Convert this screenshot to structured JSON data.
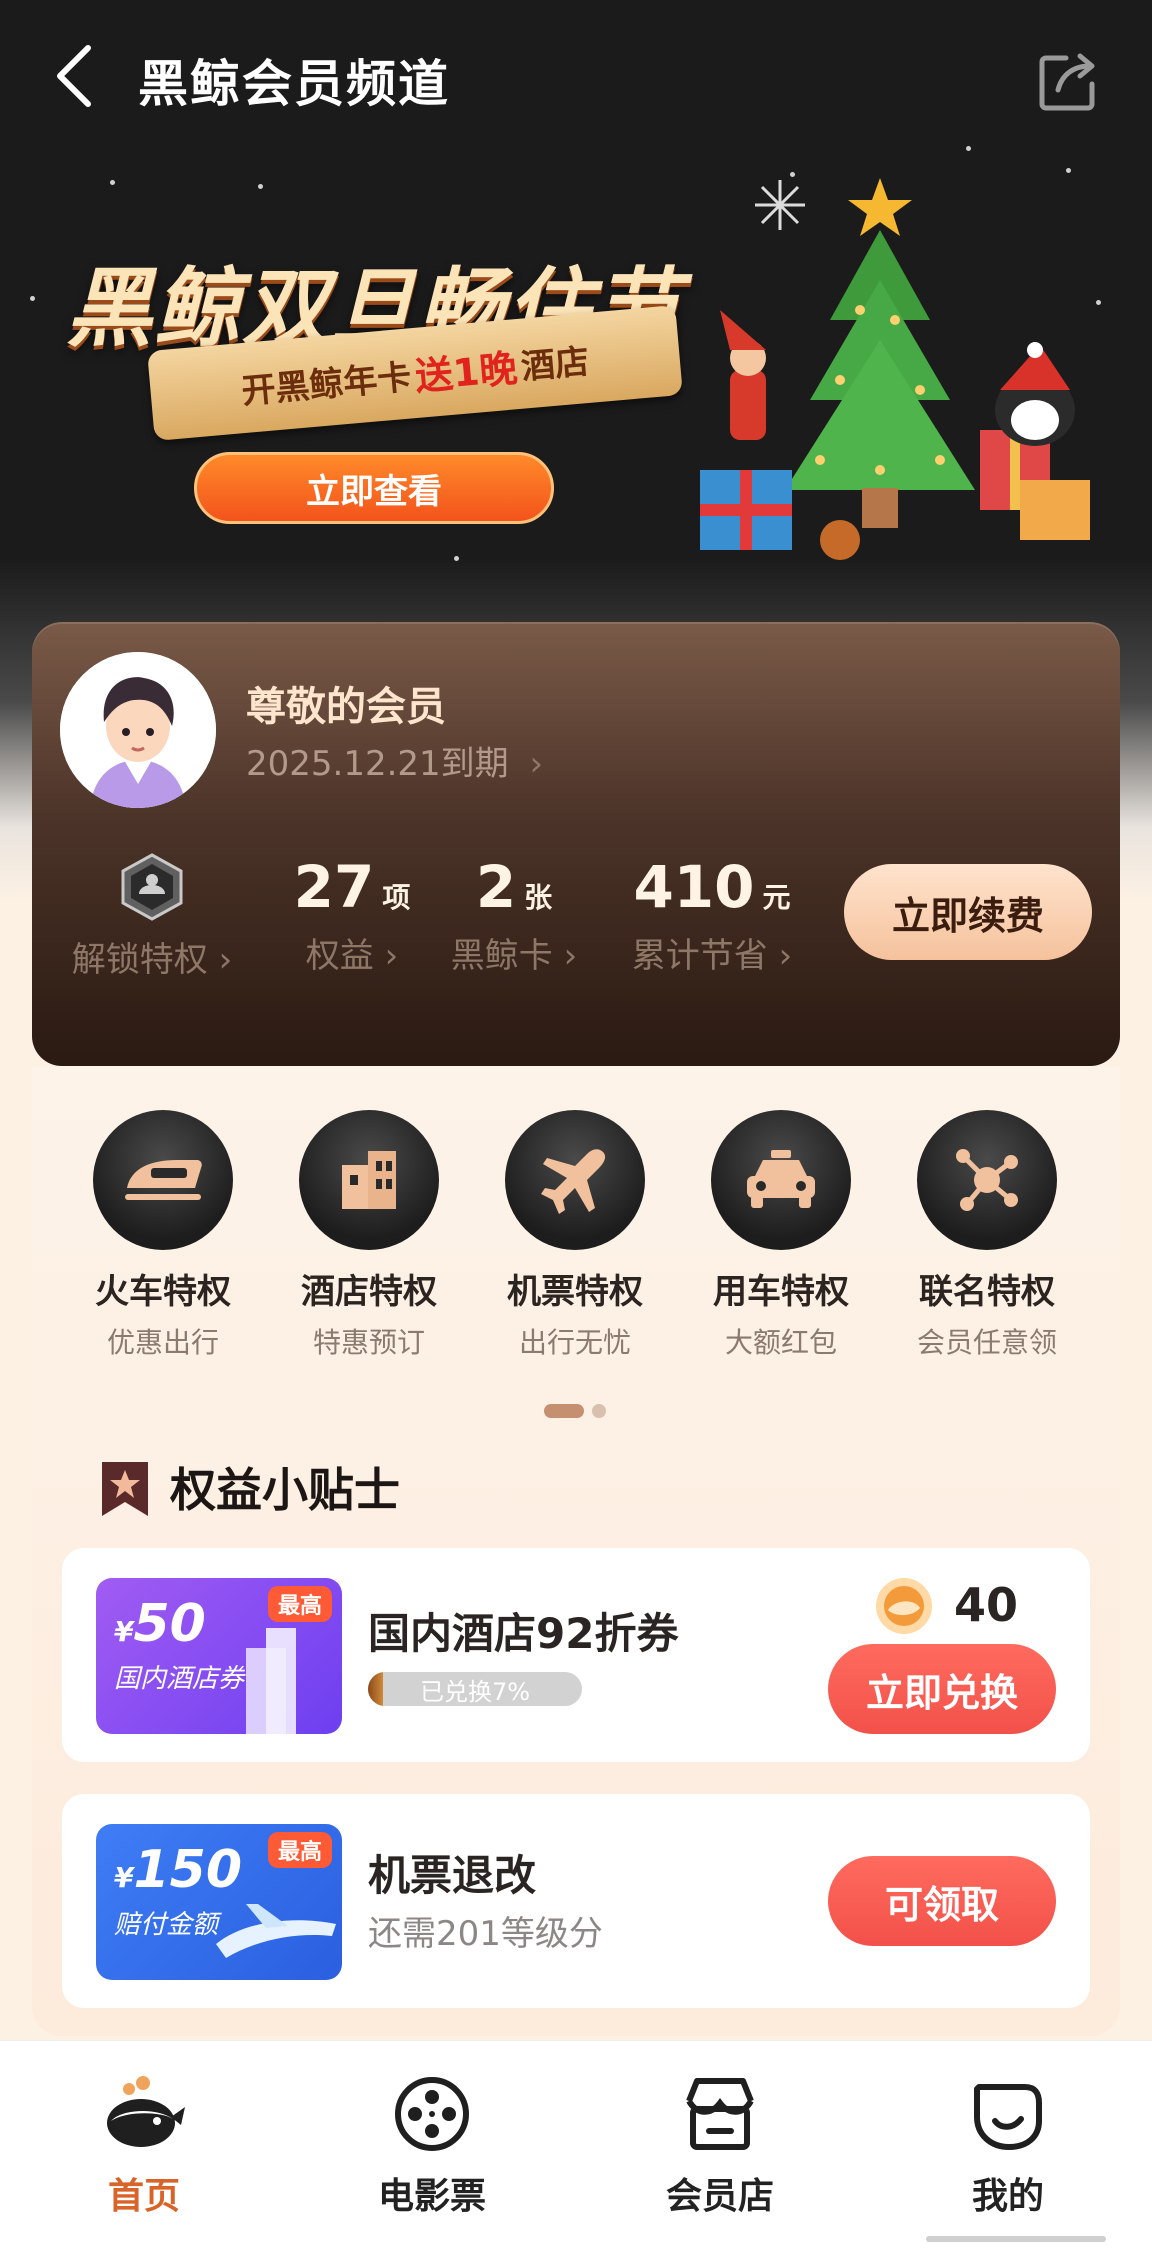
{
  "header": {
    "title": "黑鲸会员频道"
  },
  "banner": {
    "title": "黑鲸双旦畅住节",
    "ribbon_prefix": "开黑鲸年卡",
    "ribbon_highlight": "送1晚",
    "ribbon_suffix": "酒店",
    "button_label": "立即查看"
  },
  "member": {
    "name": "尊敬的会员",
    "expire": "2025.12.21到期",
    "stats": [
      {
        "value": "",
        "unit": "",
        "label": "解锁特权"
      },
      {
        "value": "27",
        "unit": "项",
        "label": "权益"
      },
      {
        "value": "2",
        "unit": "张",
        "label": "黑鲸卡"
      },
      {
        "value": "410",
        "unit": "元",
        "label": "累计节省"
      }
    ],
    "renew_label": "立即续费"
  },
  "privileges": [
    {
      "title": "火车特权",
      "sub": "优惠出行",
      "icon": "train-icon"
    },
    {
      "title": "酒店特权",
      "sub": "特惠预订",
      "icon": "hotel-icon"
    },
    {
      "title": "机票特权",
      "sub": "出行无忧",
      "icon": "plane-icon"
    },
    {
      "title": "用车特权",
      "sub": "大额红包",
      "icon": "car-icon"
    },
    {
      "title": "联名特权",
      "sub": "会员任意领",
      "icon": "cobrand-icon"
    }
  ],
  "tips": {
    "title": "权益小贴士",
    "items": [
      {
        "amount_currency": "¥",
        "amount": "50",
        "amount_desc": "国内酒店券",
        "tag": "最高",
        "name": "国内酒店92折券",
        "progress_text": "已兑换7%",
        "progress_value": 0.07,
        "coins": "40",
        "button": "立即兑换"
      },
      {
        "amount_currency": "¥",
        "amount": "150",
        "amount_desc": "赔付金额",
        "tag": "最高",
        "name": "机票退改",
        "sub": "还需201等级分",
        "button": "可领取"
      }
    ]
  },
  "nav": [
    {
      "label": "首页",
      "icon": "whale-home-icon",
      "active": true
    },
    {
      "label": "电影票",
      "icon": "film-reel-icon",
      "active": false
    },
    {
      "label": "会员店",
      "icon": "store-icon",
      "active": false
    },
    {
      "label": "我的",
      "icon": "profile-face-icon",
      "active": false
    }
  ],
  "colors": {
    "accent_orange": "#d8642a",
    "button_red": "#f2514a",
    "card_brown": "#4b3328"
  }
}
